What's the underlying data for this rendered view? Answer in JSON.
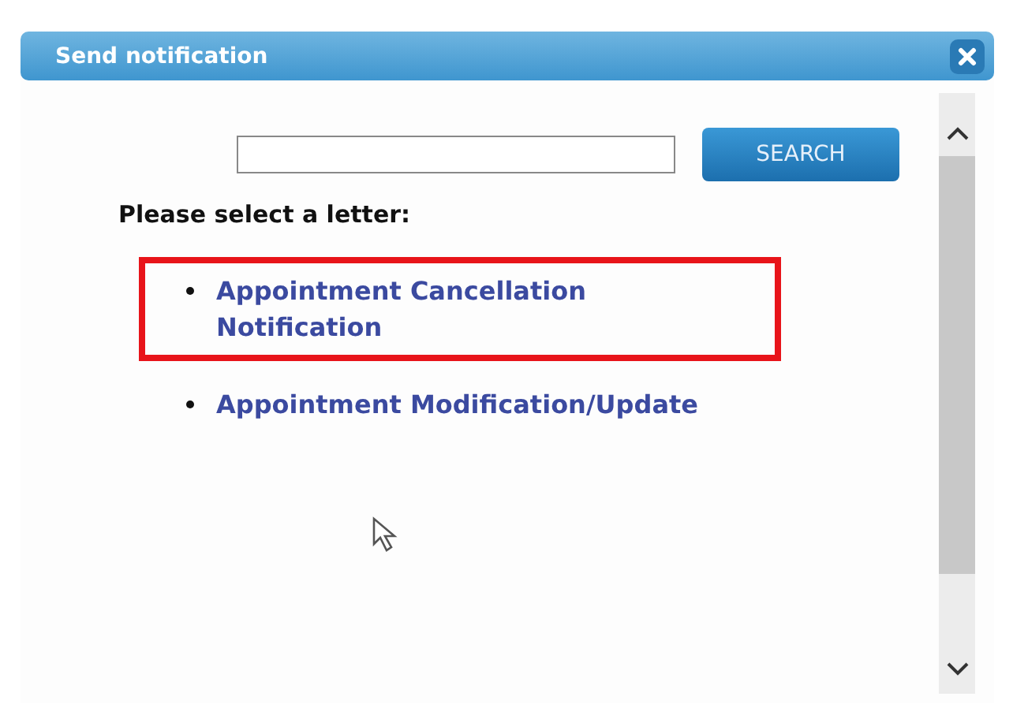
{
  "dialog": {
    "title": "Send notification"
  },
  "search": {
    "button": "SEARCH"
  },
  "prompt": "Please select a letter:",
  "letters": [
    {
      "label": "Appointment Cancellation Notification",
      "highlighted": true
    },
    {
      "label": "Appointment Modification/Update",
      "highlighted": false
    }
  ]
}
